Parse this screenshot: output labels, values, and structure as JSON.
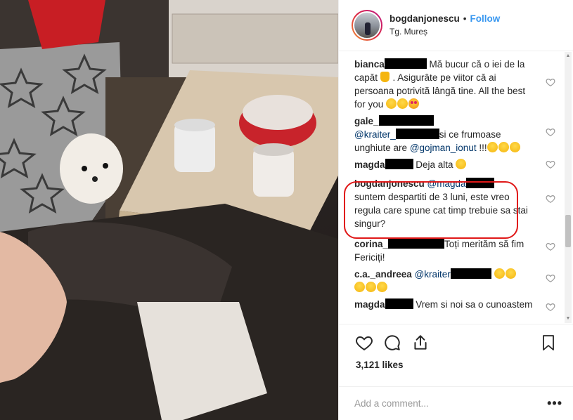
{
  "header": {
    "username": "bogdanjonescu",
    "separator": "•",
    "follow_label": "Follow",
    "location": "Tg. Mureș"
  },
  "comments": [
    {
      "user": "bianca",
      "text_parts": [
        " Mă bucur că o iei de la capăt ",
        " . Asigurâte pe viitor că ai persoana potrivită lângă tine. All the best for you "
      ]
    },
    {
      "user": "gale_",
      "mention1": "@kraiter_",
      "text": "si ce frumoase unghiute are ",
      "mention2": "@gojman_ionut",
      "tail": " !!!"
    },
    {
      "user": "magda",
      "text": " Deja alta "
    },
    {
      "user": "bogdanjonescu",
      "mention": "@magda",
      "text": "suntem despartiti de 3 luni, este vreo regula care spune cat timp trebuie sa stai singur?"
    },
    {
      "user": "corina_",
      "text": "Toți merităm să fim Fericiți!"
    },
    {
      "user": "c.a._andreea",
      "mention": "@kraiter"
    },
    {
      "user": "magda",
      "text": " Vrem si noi sa o cunoastem"
    }
  ],
  "icons": {
    "like": "heart-icon",
    "comment": "speech-bubble-icon",
    "share": "share-icon",
    "save": "bookmark-icon",
    "comment_like": "small-heart-icon",
    "options": "more-options-icon"
  },
  "likes": "3,121 likes",
  "add_comment": {
    "placeholder": "Add a comment...",
    "more_label": "•••"
  },
  "colors": {
    "follow": "#3897f0",
    "highlight": "#e01818",
    "mention": "#003569"
  }
}
